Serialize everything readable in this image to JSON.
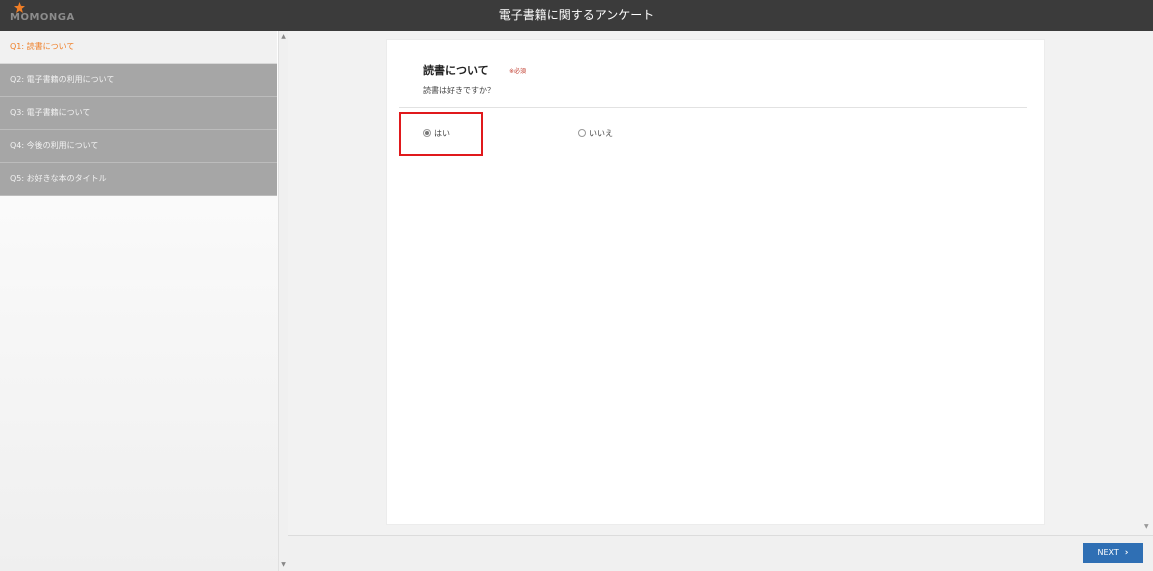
{
  "app": {
    "logo_text": "MOMONGA",
    "title": "電子書籍に関するアンケート"
  },
  "sidebar": {
    "items": [
      {
        "label": "Q1: 読書について",
        "active": true
      },
      {
        "label": "Q2: 電子書籍の利用について",
        "active": false
      },
      {
        "label": "Q3: 電子書籍について",
        "active": false
      },
      {
        "label": "Q4: 今後の利用について",
        "active": false
      },
      {
        "label": "Q5: お好きな本のタイトル",
        "active": false
      }
    ]
  },
  "question": {
    "title": "読書について",
    "required_label": "※必須",
    "subtitle": "読書は好きですか？",
    "options": [
      {
        "label": "はい",
        "selected": true
      },
      {
        "label": "いいえ",
        "selected": false
      }
    ]
  },
  "footer": {
    "next_label": "NEXT"
  },
  "colors": {
    "topbar": "#3b3b3b",
    "active_nav_text": "#f07e26",
    "inactive_nav_bg": "#a6a6a6",
    "next_button": "#2f6fb4",
    "highlight": "#e0191c",
    "required": "#c0392b"
  },
  "icons": {
    "logo": "star-logo-icon",
    "next": "chevron-right-icon"
  }
}
